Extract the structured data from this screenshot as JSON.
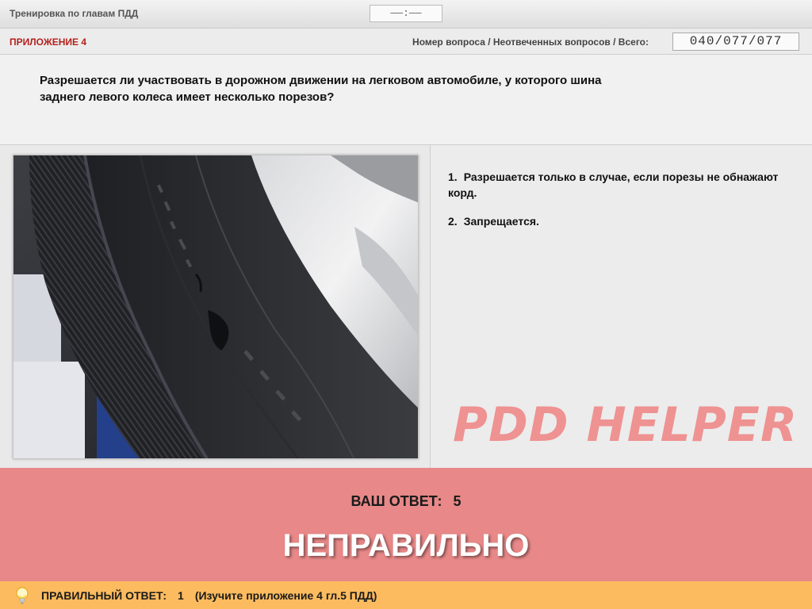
{
  "header": {
    "app_title": "Тренировка по главам ПДД",
    "timer": "——:——"
  },
  "info": {
    "appendix": "ПРИЛОЖЕНИЕ 4",
    "counter_label": "Номер вопроса / Неотвеченных вопросов / Всего:",
    "counter_value": "040/077/077"
  },
  "question": {
    "line1": "Разрешается ли участвовать в дорожном движении на легковом автомобиле, у которого шина",
    "line2": "заднего левого колеса имеет несколько порезов?"
  },
  "answers": [
    {
      "number": "1.",
      "text": "Разрешается только в случае, если порезы не обнажают корд."
    },
    {
      "number": "2.",
      "text": "Запрещается."
    }
  ],
  "watermark": "PDD HELPER",
  "result": {
    "your_answer_label": "ВАШ ОТВЕТ:",
    "your_answer_value": "5",
    "verdict": "НЕПРАВИЛЬНО"
  },
  "correct": {
    "label": "ПРАВИЛЬНЫЙ ОТВЕТ:",
    "value": "1",
    "hint": "(Изучите приложение 4 гл.5 ПДД)"
  },
  "icons": {
    "bulb": "lightbulb-icon"
  },
  "colors": {
    "appendix_red": "#b3211d",
    "result_bg": "#e88888",
    "correct_bar_bg": "#fcbb5e",
    "watermark": "#f08e8e"
  }
}
